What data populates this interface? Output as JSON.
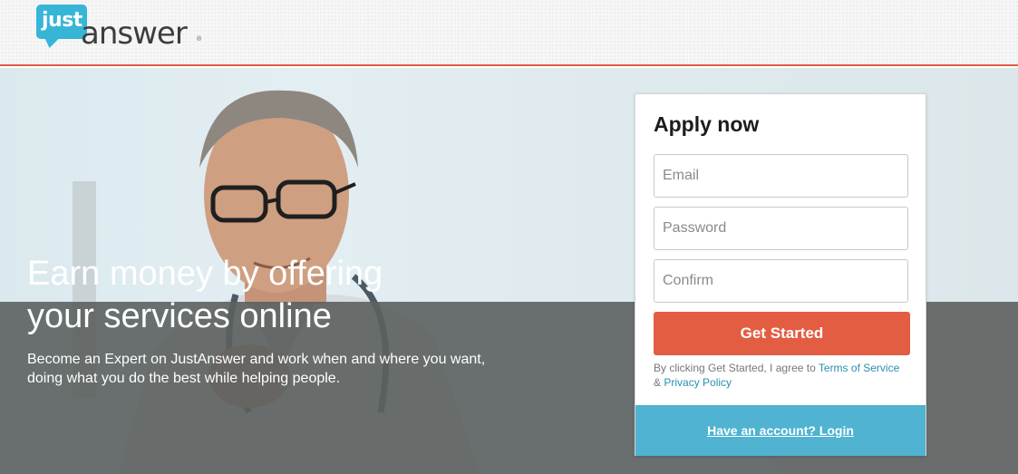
{
  "brand": {
    "logo_just": "just",
    "logo_answer": "answer",
    "logo_mark": "®",
    "accent_color": "#e25c42",
    "logo_color": "#37b5d6"
  },
  "hero": {
    "headline_line1": "Earn money by offering",
    "headline_line2": "your services online",
    "subtext_line1": "Become an Expert on JustAnswer and work when and where you want,",
    "subtext_line2": "doing what you do the best while helping people."
  },
  "form": {
    "title": "Apply now",
    "email_placeholder": "Email",
    "password_placeholder": "Password",
    "confirm_placeholder": "Confirm",
    "submit_label": "Get Started",
    "terms_prefix": "By clicking Get Started, I agree to",
    "terms_link": "Terms of Service",
    "terms_and": "&",
    "privacy_link": "Privacy Policy",
    "login_label": "Have an account? Login",
    "button_color": "#e35d42",
    "footer_color": "#4fb3d1"
  }
}
